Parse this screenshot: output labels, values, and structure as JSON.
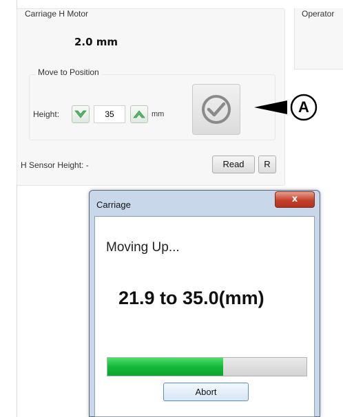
{
  "carriage_panel": {
    "title": "Carriage H Motor",
    "current_value": "2.0 mm",
    "move_group_title": "Move to Position",
    "height_label": "Height:",
    "height_value": "35",
    "unit": "mm",
    "sensor_label": "H Sensor Height: -",
    "read_label": "Read",
    "r_label": "R"
  },
  "operator_panel": {
    "title": "Operator"
  },
  "callout": {
    "letter": "A"
  },
  "dialog": {
    "title": "Carriage",
    "close_glyph": "x",
    "status": "Moving Up...",
    "range": "21.9 to 35.0(mm)",
    "progress_fraction": 0.58,
    "abort_label": "Abort"
  },
  "colors": {
    "progress_green": "#12b83a",
    "stepper_arrow_green": "#55b868",
    "close_red": "#c4412c"
  },
  "icons": {
    "down": "chevron-down-icon",
    "up": "chevron-up-icon",
    "go": "checkmark-circle-icon",
    "callout": "arrow-left-icon"
  }
}
